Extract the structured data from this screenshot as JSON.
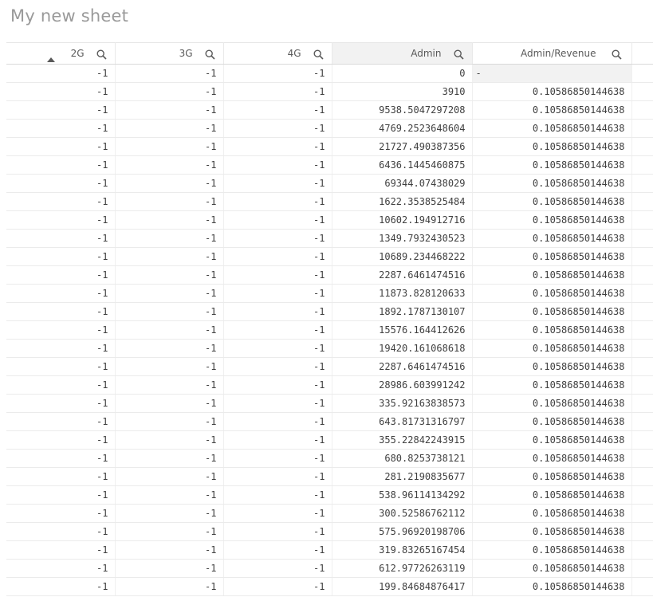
{
  "sheet": {
    "title": "My new sheet"
  },
  "table": {
    "columns": [
      {
        "label": "2G",
        "icon": "search-icon",
        "sorted": "ascending"
      },
      {
        "label": "3G",
        "icon": "search-icon"
      },
      {
        "label": "4G",
        "icon": "search-icon"
      },
      {
        "label": "Admin",
        "icon": "search-icon"
      },
      {
        "label": "Admin/Revenue",
        "icon": "search-icon"
      }
    ],
    "rows": [
      [
        "-1",
        "-1",
        "-1",
        "0",
        "-"
      ],
      [
        "-1",
        "-1",
        "-1",
        "3910",
        "0.10586850144638"
      ],
      [
        "-1",
        "-1",
        "-1",
        "9538.5047297208",
        "0.10586850144638"
      ],
      [
        "-1",
        "-1",
        "-1",
        "4769.2523648604",
        "0.10586850144638"
      ],
      [
        "-1",
        "-1",
        "-1",
        "21727.490387356",
        "0.10586850144638"
      ],
      [
        "-1",
        "-1",
        "-1",
        "6436.1445460875",
        "0.10586850144638"
      ],
      [
        "-1",
        "-1",
        "-1",
        "69344.07438029",
        "0.10586850144638"
      ],
      [
        "-1",
        "-1",
        "-1",
        "1622.3538525484",
        "0.10586850144638"
      ],
      [
        "-1",
        "-1",
        "-1",
        "10602.194912716",
        "0.10586850144638"
      ],
      [
        "-1",
        "-1",
        "-1",
        "1349.7932430523",
        "0.10586850144638"
      ],
      [
        "-1",
        "-1",
        "-1",
        "10689.234468222",
        "0.10586850144638"
      ],
      [
        "-1",
        "-1",
        "-1",
        "2287.6461474516",
        "0.10586850144638"
      ],
      [
        "-1",
        "-1",
        "-1",
        "11873.828120633",
        "0.10586850144638"
      ],
      [
        "-1",
        "-1",
        "-1",
        "1892.1787130107",
        "0.10586850144638"
      ],
      [
        "-1",
        "-1",
        "-1",
        "15576.164412626",
        "0.10586850144638"
      ],
      [
        "-1",
        "-1",
        "-1",
        "19420.161068618",
        "0.10586850144638"
      ],
      [
        "-1",
        "-1",
        "-1",
        "2287.6461474516",
        "0.10586850144638"
      ],
      [
        "-1",
        "-1",
        "-1",
        "28986.603991242",
        "0.10586850144638"
      ],
      [
        "-1",
        "-1",
        "-1",
        "335.92163838573",
        "0.10586850144638"
      ],
      [
        "-1",
        "-1",
        "-1",
        "643.81731316797",
        "0.10586850144638"
      ],
      [
        "-1",
        "-1",
        "-1",
        "355.22842243915",
        "0.10586850144638"
      ],
      [
        "-1",
        "-1",
        "-1",
        "680.8253738121",
        "0.10586850144638"
      ],
      [
        "-1",
        "-1",
        "-1",
        "281.2190835677",
        "0.10586850144638"
      ],
      [
        "-1",
        "-1",
        "-1",
        "538.96114134292",
        "0.10586850144638"
      ],
      [
        "-1",
        "-1",
        "-1",
        "300.52586762112",
        "0.10586850144638"
      ],
      [
        "-1",
        "-1",
        "-1",
        "575.96920198706",
        "0.10586850144638"
      ],
      [
        "-1",
        "-1",
        "-1",
        "319.83265167454",
        "0.10586850144638"
      ],
      [
        "-1",
        "-1",
        "-1",
        "612.97726263119",
        "0.10586850144638"
      ],
      [
        "-1",
        "-1",
        "-1",
        "199.84684876417",
        "0.10586850144638"
      ]
    ]
  }
}
